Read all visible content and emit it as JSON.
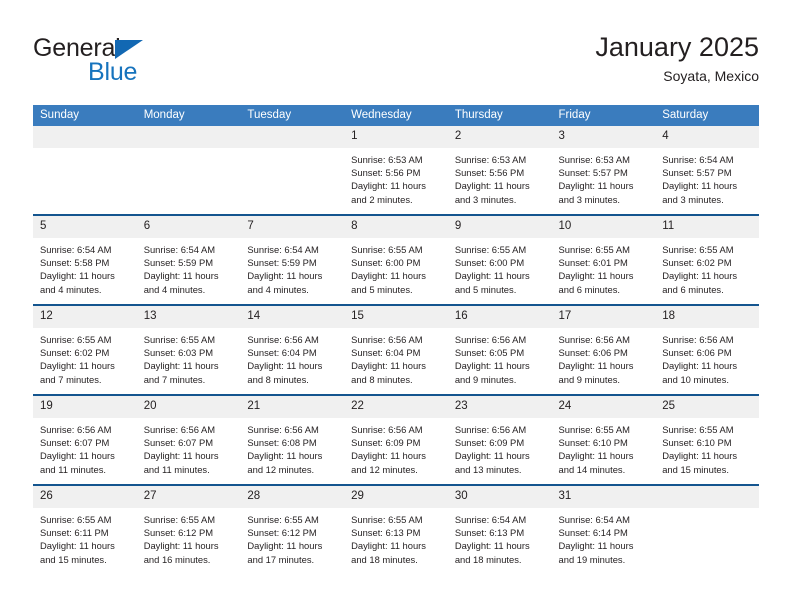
{
  "brand": {
    "name_top": "General",
    "name_bottom": "Blue",
    "triangle_color": "#1268b3",
    "blue_color": "#1673bd"
  },
  "header": {
    "title": "January 2025",
    "subtitle": "Soyata, Mexico"
  },
  "theme": {
    "header_row_bg": "#3a7cbe",
    "row_separator": "#14558f",
    "date_band_bg": "#f0f0f0",
    "text": "#231f20"
  },
  "weekday_headers": [
    "Sunday",
    "Monday",
    "Tuesday",
    "Wednesday",
    "Thursday",
    "Friday",
    "Saturday"
  ],
  "labels": {
    "sunrise_prefix": "Sunrise:",
    "sunset_prefix": "Sunset:",
    "daylight_prefix": "Daylight:"
  },
  "weeks": [
    [
      {
        "day": "",
        "sunrise": "",
        "sunset": "",
        "daylight_line1": "",
        "daylight_line2": ""
      },
      {
        "day": "",
        "sunrise": "",
        "sunset": "",
        "daylight_line1": "",
        "daylight_line2": ""
      },
      {
        "day": "",
        "sunrise": "",
        "sunset": "",
        "daylight_line1": "",
        "daylight_line2": ""
      },
      {
        "day": "1",
        "sunrise": "Sunrise: 6:53 AM",
        "sunset": "Sunset: 5:56 PM",
        "daylight_line1": "Daylight: 11 hours",
        "daylight_line2": "and 2 minutes."
      },
      {
        "day": "2",
        "sunrise": "Sunrise: 6:53 AM",
        "sunset": "Sunset: 5:56 PM",
        "daylight_line1": "Daylight: 11 hours",
        "daylight_line2": "and 3 minutes."
      },
      {
        "day": "3",
        "sunrise": "Sunrise: 6:53 AM",
        "sunset": "Sunset: 5:57 PM",
        "daylight_line1": "Daylight: 11 hours",
        "daylight_line2": "and 3 minutes."
      },
      {
        "day": "4",
        "sunrise": "Sunrise: 6:54 AM",
        "sunset": "Sunset: 5:57 PM",
        "daylight_line1": "Daylight: 11 hours",
        "daylight_line2": "and 3 minutes."
      }
    ],
    [
      {
        "day": "5",
        "sunrise": "Sunrise: 6:54 AM",
        "sunset": "Sunset: 5:58 PM",
        "daylight_line1": "Daylight: 11 hours",
        "daylight_line2": "and 4 minutes."
      },
      {
        "day": "6",
        "sunrise": "Sunrise: 6:54 AM",
        "sunset": "Sunset: 5:59 PM",
        "daylight_line1": "Daylight: 11 hours",
        "daylight_line2": "and 4 minutes."
      },
      {
        "day": "7",
        "sunrise": "Sunrise: 6:54 AM",
        "sunset": "Sunset: 5:59 PM",
        "daylight_line1": "Daylight: 11 hours",
        "daylight_line2": "and 4 minutes."
      },
      {
        "day": "8",
        "sunrise": "Sunrise: 6:55 AM",
        "sunset": "Sunset: 6:00 PM",
        "daylight_line1": "Daylight: 11 hours",
        "daylight_line2": "and 5 minutes."
      },
      {
        "day": "9",
        "sunrise": "Sunrise: 6:55 AM",
        "sunset": "Sunset: 6:00 PM",
        "daylight_line1": "Daylight: 11 hours",
        "daylight_line2": "and 5 minutes."
      },
      {
        "day": "10",
        "sunrise": "Sunrise: 6:55 AM",
        "sunset": "Sunset: 6:01 PM",
        "daylight_line1": "Daylight: 11 hours",
        "daylight_line2": "and 6 minutes."
      },
      {
        "day": "11",
        "sunrise": "Sunrise: 6:55 AM",
        "sunset": "Sunset: 6:02 PM",
        "daylight_line1": "Daylight: 11 hours",
        "daylight_line2": "and 6 minutes."
      }
    ],
    [
      {
        "day": "12",
        "sunrise": "Sunrise: 6:55 AM",
        "sunset": "Sunset: 6:02 PM",
        "daylight_line1": "Daylight: 11 hours",
        "daylight_line2": "and 7 minutes."
      },
      {
        "day": "13",
        "sunrise": "Sunrise: 6:55 AM",
        "sunset": "Sunset: 6:03 PM",
        "daylight_line1": "Daylight: 11 hours",
        "daylight_line2": "and 7 minutes."
      },
      {
        "day": "14",
        "sunrise": "Sunrise: 6:56 AM",
        "sunset": "Sunset: 6:04 PM",
        "daylight_line1": "Daylight: 11 hours",
        "daylight_line2": "and 8 minutes."
      },
      {
        "day": "15",
        "sunrise": "Sunrise: 6:56 AM",
        "sunset": "Sunset: 6:04 PM",
        "daylight_line1": "Daylight: 11 hours",
        "daylight_line2": "and 8 minutes."
      },
      {
        "day": "16",
        "sunrise": "Sunrise: 6:56 AM",
        "sunset": "Sunset: 6:05 PM",
        "daylight_line1": "Daylight: 11 hours",
        "daylight_line2": "and 9 minutes."
      },
      {
        "day": "17",
        "sunrise": "Sunrise: 6:56 AM",
        "sunset": "Sunset: 6:06 PM",
        "daylight_line1": "Daylight: 11 hours",
        "daylight_line2": "and 9 minutes."
      },
      {
        "day": "18",
        "sunrise": "Sunrise: 6:56 AM",
        "sunset": "Sunset: 6:06 PM",
        "daylight_line1": "Daylight: 11 hours",
        "daylight_line2": "and 10 minutes."
      }
    ],
    [
      {
        "day": "19",
        "sunrise": "Sunrise: 6:56 AM",
        "sunset": "Sunset: 6:07 PM",
        "daylight_line1": "Daylight: 11 hours",
        "daylight_line2": "and 11 minutes."
      },
      {
        "day": "20",
        "sunrise": "Sunrise: 6:56 AM",
        "sunset": "Sunset: 6:07 PM",
        "daylight_line1": "Daylight: 11 hours",
        "daylight_line2": "and 11 minutes."
      },
      {
        "day": "21",
        "sunrise": "Sunrise: 6:56 AM",
        "sunset": "Sunset: 6:08 PM",
        "daylight_line1": "Daylight: 11 hours",
        "daylight_line2": "and 12 minutes."
      },
      {
        "day": "22",
        "sunrise": "Sunrise: 6:56 AM",
        "sunset": "Sunset: 6:09 PM",
        "daylight_line1": "Daylight: 11 hours",
        "daylight_line2": "and 12 minutes."
      },
      {
        "day": "23",
        "sunrise": "Sunrise: 6:56 AM",
        "sunset": "Sunset: 6:09 PM",
        "daylight_line1": "Daylight: 11 hours",
        "daylight_line2": "and 13 minutes."
      },
      {
        "day": "24",
        "sunrise": "Sunrise: 6:55 AM",
        "sunset": "Sunset: 6:10 PM",
        "daylight_line1": "Daylight: 11 hours",
        "daylight_line2": "and 14 minutes."
      },
      {
        "day": "25",
        "sunrise": "Sunrise: 6:55 AM",
        "sunset": "Sunset: 6:10 PM",
        "daylight_line1": "Daylight: 11 hours",
        "daylight_line2": "and 15 minutes."
      }
    ],
    [
      {
        "day": "26",
        "sunrise": "Sunrise: 6:55 AM",
        "sunset": "Sunset: 6:11 PM",
        "daylight_line1": "Daylight: 11 hours",
        "daylight_line2": "and 15 minutes."
      },
      {
        "day": "27",
        "sunrise": "Sunrise: 6:55 AM",
        "sunset": "Sunset: 6:12 PM",
        "daylight_line1": "Daylight: 11 hours",
        "daylight_line2": "and 16 minutes."
      },
      {
        "day": "28",
        "sunrise": "Sunrise: 6:55 AM",
        "sunset": "Sunset: 6:12 PM",
        "daylight_line1": "Daylight: 11 hours",
        "daylight_line2": "and 17 minutes."
      },
      {
        "day": "29",
        "sunrise": "Sunrise: 6:55 AM",
        "sunset": "Sunset: 6:13 PM",
        "daylight_line1": "Daylight: 11 hours",
        "daylight_line2": "and 18 minutes."
      },
      {
        "day": "30",
        "sunrise": "Sunrise: 6:54 AM",
        "sunset": "Sunset: 6:13 PM",
        "daylight_line1": "Daylight: 11 hours",
        "daylight_line2": "and 18 minutes."
      },
      {
        "day": "31",
        "sunrise": "Sunrise: 6:54 AM",
        "sunset": "Sunset: 6:14 PM",
        "daylight_line1": "Daylight: 11 hours",
        "daylight_line2": "and 19 minutes."
      },
      {
        "day": "",
        "sunrise": "",
        "sunset": "",
        "daylight_line1": "",
        "daylight_line2": ""
      }
    ]
  ]
}
